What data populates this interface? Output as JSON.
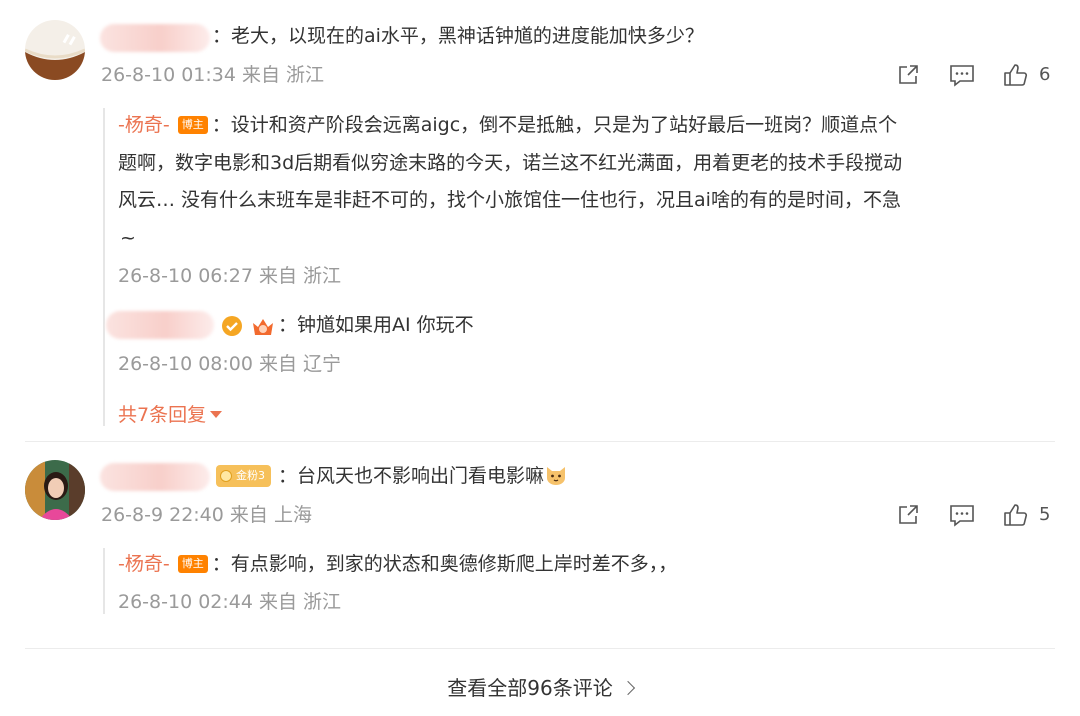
{
  "comments": [
    {
      "text": "：老大，以现在的ai水平，黑神话钟馗的进度能加快多少？",
      "time": "26-8-10 01:34 来自 浙江",
      "likes": "6",
      "replies": [
        {
          "author": "-杨奇-",
          "badge": "博主",
          "lines": [
            "：设计和资产阶段会远离aigc，倒不是抵触，只是为了站好最后一班岗？顺道点个",
            "题啊，数字电影和3d后期看似穷途末路的今天，诺兰这不红光满面，用着更老的技术手段搅动",
            "风云… 没有什么末班车是非赶不可的，找个小旅馆住一住也行，况且ai啥的有的是时间，不急",
            "~"
          ],
          "time": "26-8-10 06:27 来自 浙江"
        },
        {
          "text": "：钟馗如果用AI 你玩不",
          "time": "26-8-10 08:00 来自 辽宁"
        }
      ],
      "more_replies": "共7条回复"
    },
    {
      "badge": "金粉3",
      "text": "：台风天也不影响出门看电影嘛",
      "time": "26-8-9 22:40 来自 上海",
      "likes": "5",
      "replies": [
        {
          "author": "-杨奇-",
          "badge": "博主",
          "text": "：有点影响，到家的状态和奥德修斯爬上岸时差不多，，",
          "time": "26-8-10 02:44 来自 浙江"
        }
      ]
    }
  ],
  "footer": {
    "view_all": "查看全部96条评论"
  },
  "colors": {
    "author": "#eb7350",
    "badge": "#ff8200",
    "meta": "#9a9a9a"
  }
}
